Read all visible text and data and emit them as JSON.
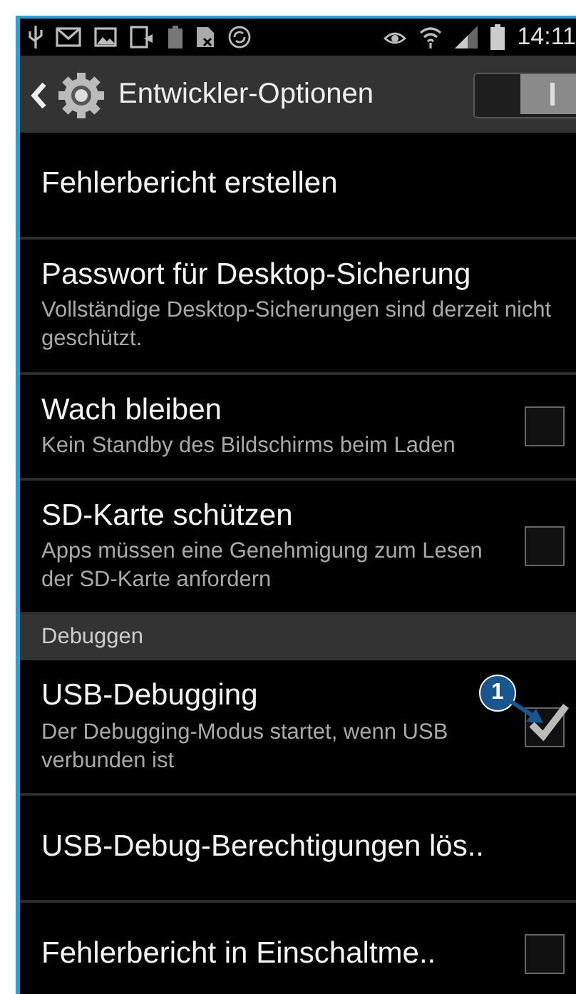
{
  "status_bar": {
    "time": "14:11"
  },
  "action_bar": {
    "title": "Entwickler-Optionen",
    "master_switch": {
      "on": true
    }
  },
  "items": [
    {
      "kind": "action",
      "title": "Fehlerbericht erstellen"
    },
    {
      "kind": "action",
      "title": "Passwort für Desktop-Sicherung",
      "summary": "Vollständige Desktop-Sicherungen sind derzeit nicht geschützt."
    },
    {
      "kind": "checkbox",
      "title": "Wach bleiben",
      "summary": "Kein Standby des Bildschirms beim Laden",
      "checked": false
    },
    {
      "kind": "checkbox",
      "title": "SD-Karte schützen",
      "summary": "Apps müssen eine Genehmigung zum Lesen der SD-Karte anfordern",
      "checked": false
    },
    {
      "kind": "header",
      "title": "Debuggen"
    },
    {
      "kind": "checkbox",
      "title": "USB-Debugging",
      "summary": "Der Debugging-Modus startet, wenn USB verbunden ist",
      "checked": true,
      "callout": "1"
    },
    {
      "kind": "action",
      "title": "USB-Debug-Berechtigungen lös.."
    },
    {
      "kind": "checkbox",
      "title": "Fehlerbericht in Einschaltme..",
      "checked": false
    }
  ]
}
